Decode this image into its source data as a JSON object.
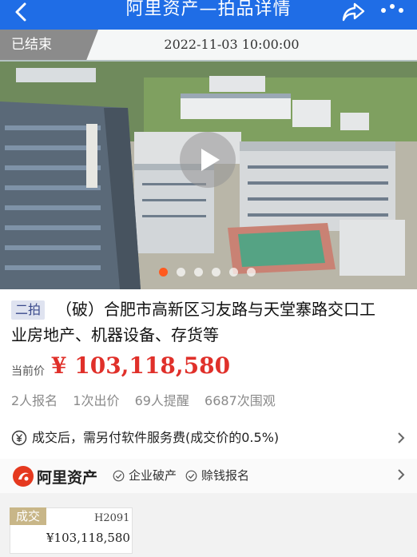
{
  "header": {
    "title": "阿里资产—拍品详情"
  },
  "auction_status": {
    "badge": "已结束",
    "end_time": "2022-11-03 10:00:00"
  },
  "gallery": {
    "slide_count": 6,
    "active_slide": 1
  },
  "item": {
    "round_tag": "二拍",
    "title_line1": "（破）合肥市高新区习友路与天堂寨路交口工",
    "title_line2": "业房地产、机器设备、存货等",
    "price_label": "当前价",
    "price": "¥ 103,118,580",
    "stats": {
      "registered": "2人报名",
      "bids": "1次出价",
      "reminders": "69人提醒",
      "views": "6687次围观"
    }
  },
  "notice": {
    "text": "成交后，需另付软件服务费(成交价的0.5%)"
  },
  "seller": {
    "name": "阿里资产",
    "tags": [
      "企业破产",
      "赊钱报名"
    ]
  },
  "result_card": {
    "tag": "成交",
    "code": "H2091",
    "price": "¥103,118,580"
  },
  "colors": {
    "brand_blue": "#1f6de6",
    "price_red": "#e0302a",
    "accent_orange": "#ff5a1f"
  }
}
